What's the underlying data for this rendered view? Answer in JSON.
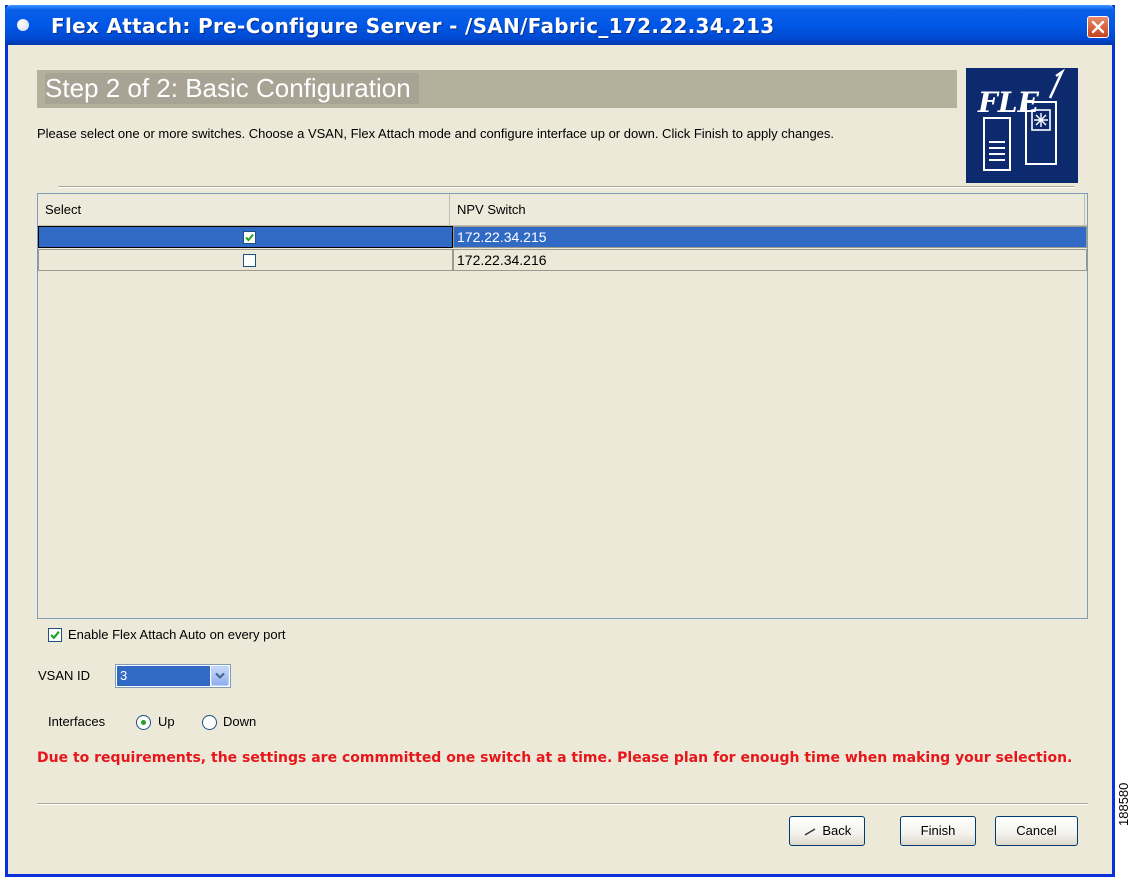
{
  "window": {
    "title": "Flex Attach: Pre-Configure Server - /SAN/Fabric_172.22.34.213"
  },
  "wizard": {
    "step_title": "Step 2 of 2:  Basic Configuration",
    "instructions": "Please select one or more switches.  Choose a VSAN, Flex Attach mode and configure interface up or down.  Click Finish to apply changes.",
    "logo_text": "FLEX"
  },
  "table": {
    "columns": [
      "Select",
      "NPV Switch"
    ],
    "rows": [
      {
        "selected": true,
        "checked": true,
        "npv_switch": "172.22.34.215"
      },
      {
        "selected": false,
        "checked": false,
        "npv_switch": "172.22.34.216"
      }
    ]
  },
  "options": {
    "enable_auto_label": "Enable Flex Attach Auto on every port",
    "enable_auto_checked": true,
    "vsan_label": "VSAN ID",
    "vsan_value": "3",
    "interfaces_label": "Interfaces",
    "interfaces_options": [
      "Up",
      "Down"
    ],
    "interfaces_selected": "Up"
  },
  "warning": "Due to requirements, the settings are commmitted one switch at a time. Please plan for enough time when making your selection.",
  "buttons": {
    "back": "Back",
    "finish": "Finish",
    "cancel": "Cancel"
  },
  "figure_number": "188580",
  "icons": [
    "window-menu-icon",
    "close-icon",
    "checkbox-check-icon",
    "dropdown-arrow-icon",
    "back-arrow-icon"
  ]
}
